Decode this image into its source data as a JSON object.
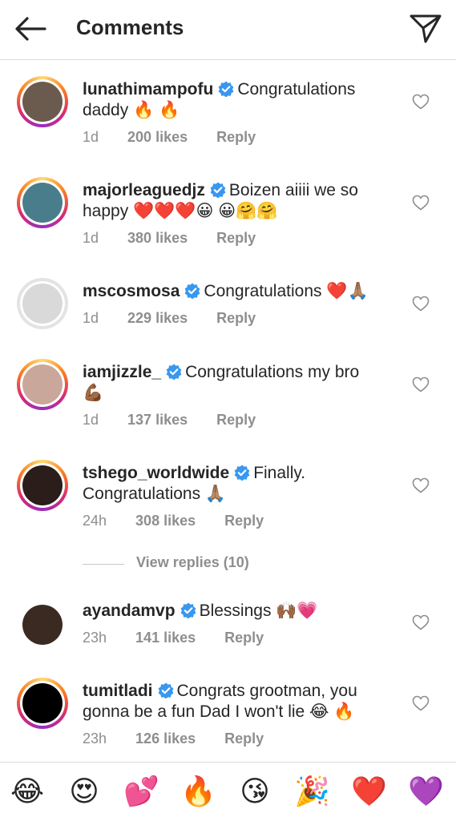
{
  "header": {
    "title": "Comments",
    "back_icon": "back-arrow-icon",
    "send_icon": "paper-plane-icon"
  },
  "comments": [
    {
      "username": "lunathimampofu",
      "text": "Congratulations daddy 🔥 🔥",
      "time": "1d",
      "likes": "200 likes",
      "reply": "Reply",
      "ring": "gradient",
      "avatar_color": "#6b5a4e"
    },
    {
      "username": "majorleaguedjz",
      "text": "Boizen aiiii we so happy ❤️❤️❤️😀 😀🤗🤗",
      "time": "1d",
      "likes": "380 likes",
      "reply": "Reply",
      "ring": "gradient",
      "avatar_color": "#4a7d8c"
    },
    {
      "username": "mscosmosa",
      "text": "Congratulations ❤️🙏🏽",
      "time": "1d",
      "likes": "229 likes",
      "reply": "Reply",
      "ring": "plain",
      "avatar_color": "#d9d9d9"
    },
    {
      "username": "iamjizzle_",
      "text": "Congratulations my bro 💪🏾",
      "time": "1d",
      "likes": "137 likes",
      "reply": "Reply",
      "ring": "gradient",
      "avatar_color": "#c9a79b"
    },
    {
      "username": "tshego_worldwide",
      "text": "Finally. Congratulations 🙏🏽",
      "time": "24h",
      "likes": "308 likes",
      "reply": "Reply",
      "ring": "gradient",
      "avatar_color": "#2a1d1a"
    },
    {
      "username": "ayandamvp",
      "text": "Blessings 🙌🏾💗",
      "time": "23h",
      "likes": "141 likes",
      "reply": "Reply",
      "ring": "none",
      "avatar_color": "#3b2a22"
    },
    {
      "username": "tumitladi",
      "text": "Congrats grootman, you gonna be a fun Dad I won't lie 😂 🔥",
      "time": "23h",
      "likes": "126 likes",
      "reply": "Reply",
      "ring": "gradient",
      "avatar_color": "#000000"
    }
  ],
  "view_replies": "View replies (10)",
  "emoji_bar": [
    "😂",
    "😍",
    "💕",
    "🔥",
    "😘",
    "🎉",
    "❤️",
    "💜"
  ],
  "colors": {
    "verified_badge": "#3897f0",
    "text_primary": "#262626",
    "text_secondary": "#8e8e8e"
  }
}
